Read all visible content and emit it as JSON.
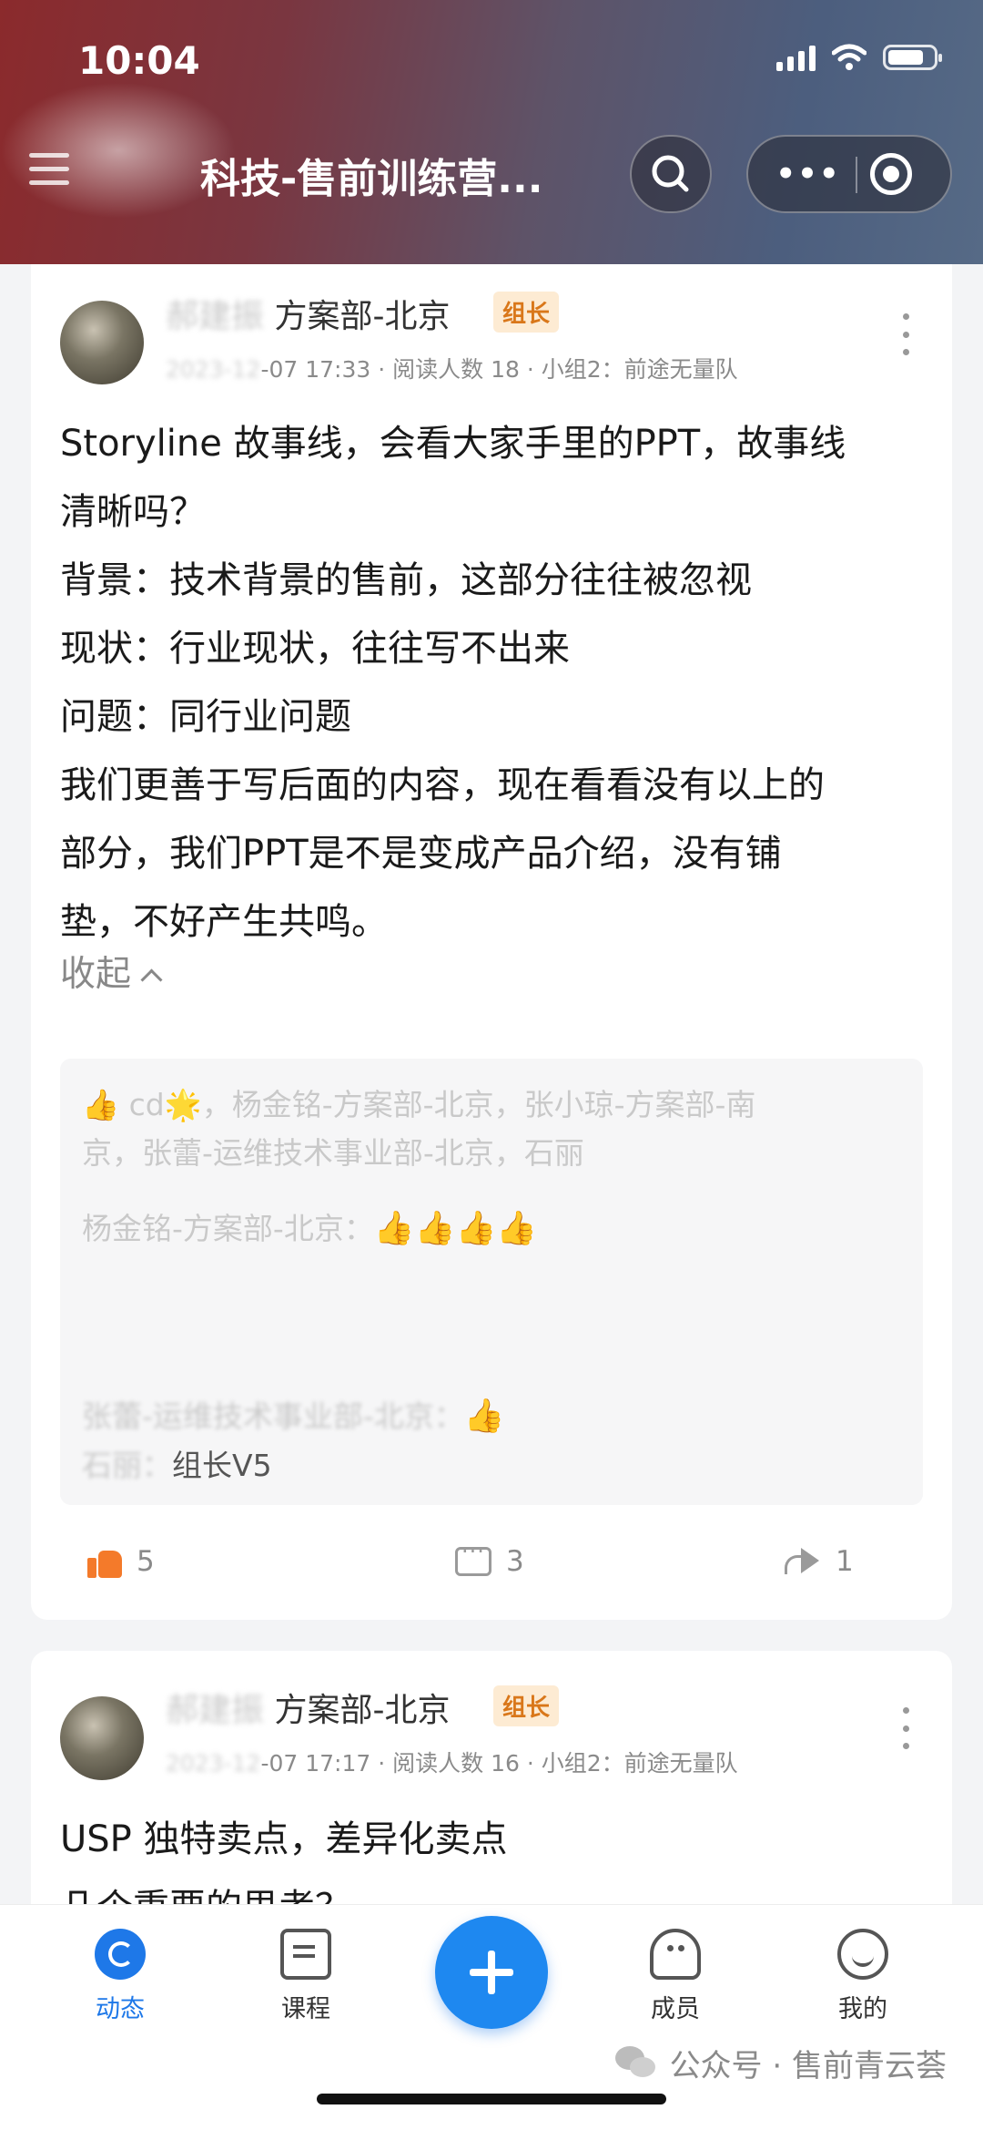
{
  "status_bar": {
    "time": "10:04"
  },
  "header": {
    "title": "科技-售前训练营...",
    "icons": [
      "back-icon",
      "search-icon",
      "more-icon",
      "target-icon"
    ]
  },
  "posts": [
    {
      "author_visible": "方案部-北京",
      "author_masked": "郝建振",
      "badge": "组长",
      "meta_masked_date": "2023-12",
      "meta_visible": "-07 17:33 · 阅读人数 18 · 小组2：前途无量队",
      "lines": [
        "Storyline 故事线，会看大家手里的PPT，故事线",
        "清晰吗？",
        "背景：技术背景的售前，这部分往往被忽视",
        "现状：行业现状，往往写不出来",
        "问题：同行业问题",
        "我们更善于写后面的内容，现在看看没有以上的",
        "部分，我们PPT是不是变成产品介绍，没有铺",
        "垫，不好产生共鸣。"
      ],
      "collapse_label": "收起",
      "likes_text_line1": "cd🌟，杨金铭-方案部-北京，张小琼-方案部-南",
      "likes_text_line2": "京，张蕾-运维技术事业部-北京，石丽",
      "comments": [
        {
          "author": "杨金铭-方案部-北京：",
          "content": "👍👍👍👍"
        },
        {
          "author": "张蕾-运维技术事业部-北京：",
          "content": "👍"
        },
        {
          "author": "石丽：",
          "content": "组长V5"
        }
      ],
      "like_count": "5",
      "comment_count": "3",
      "share_count": "1"
    },
    {
      "author_visible": "方案部-北京",
      "author_masked": "郝建振",
      "badge": "组长",
      "meta_masked_date": "2023-12",
      "meta_visible": "-07 17:17 · 阅读人数 16 · 小组2：前途无量队",
      "lines": [
        "USP 独特卖点，差异化卖点",
        "几个重要的思考？"
      ]
    }
  ],
  "tabbar": {
    "tabs": [
      {
        "label": "动态",
        "icon": "feed-icon",
        "active": true
      },
      {
        "label": "课程",
        "icon": "course-icon",
        "active": false
      },
      {
        "label": "成员",
        "icon": "members-icon",
        "active": false
      },
      {
        "label": "我的",
        "icon": "profile-icon",
        "active": false
      }
    ],
    "fab_icon": "plus-icon"
  },
  "watermark": "公众号 · 售前青云荟",
  "colors": {
    "accent": "#1e78e8",
    "badge_text": "#d9771a",
    "like": "#f47a2a"
  }
}
